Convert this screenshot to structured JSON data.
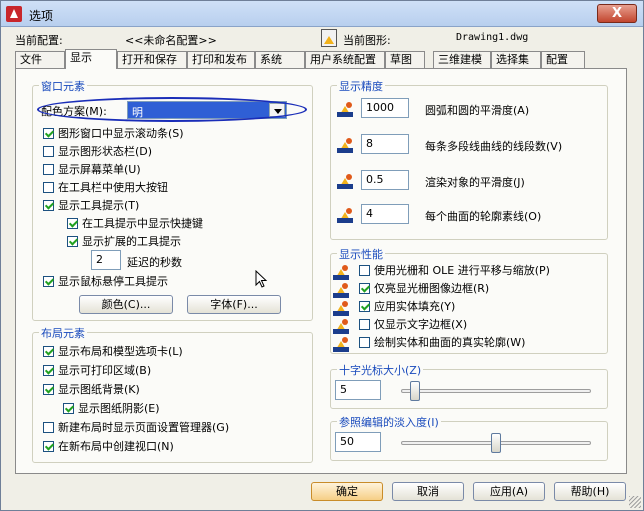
{
  "window": {
    "title": "选项",
    "close_label": "X"
  },
  "profile": {
    "current_profile_label": "当前配置:",
    "current_profile_value": "<<未命名配置>>",
    "current_drawing_label": "当前图形:",
    "current_drawing_value": "Drawing1.dwg"
  },
  "tabs": [
    {
      "label": "文件"
    },
    {
      "label": "显示"
    },
    {
      "label": "打开和保存"
    },
    {
      "label": "打印和发布"
    },
    {
      "label": "系统"
    },
    {
      "label": "用户系统配置"
    },
    {
      "label": "草图"
    },
    {
      "label": "三维建模"
    },
    {
      "label": "选择集"
    },
    {
      "label": "配置"
    }
  ],
  "window_elements": {
    "title": "窗口元素",
    "color_scheme_label": "配色方案(M):",
    "color_scheme_value": "明",
    "checkboxes": [
      {
        "label": "图形窗口中显示滚动条(S)",
        "checked": true
      },
      {
        "label": "显示图形状态栏(D)",
        "checked": false
      },
      {
        "label": "显示屏幕菜单(U)",
        "checked": false
      },
      {
        "label": "在工具栏中使用大按钮",
        "checked": false
      },
      {
        "label": "显示工具提示(T)",
        "checked": true
      },
      {
        "label": "在工具提示中显示快捷键",
        "checked": true
      },
      {
        "label": "显示扩展的工具提示",
        "checked": true
      },
      {
        "label": "显示鼠标悬停工具提示",
        "checked": true
      }
    ],
    "delay_value": "2",
    "delay_label": "延迟的秒数",
    "colors_button": "颜色(C)...",
    "fonts_button": "字体(F)..."
  },
  "layout_elements": {
    "title": "布局元素",
    "checkboxes": [
      {
        "label": "显示布局和模型选项卡(L)",
        "checked": true
      },
      {
        "label": "显示可打印区域(B)",
        "checked": true
      },
      {
        "label": "显示图纸背景(K)",
        "checked": true
      },
      {
        "label": "显示图纸阴影(E)",
        "checked": true
      },
      {
        "label": "新建布局时显示页面设置管理器(G)",
        "checked": false
      },
      {
        "label": "在新布局中创建视口(N)",
        "checked": true
      }
    ]
  },
  "display_resolution": {
    "title": "显示精度",
    "items": [
      {
        "value": "1000",
        "label": "圆弧和圆的平滑度(A)"
      },
      {
        "value": "8",
        "label": "每条多段线曲线的线段数(V)"
      },
      {
        "value": "0.5",
        "label": "渲染对象的平滑度(J)"
      },
      {
        "value": "4",
        "label": "每个曲面的轮廓素线(O)"
      }
    ]
  },
  "display_performance": {
    "title": "显示性能",
    "checkboxes": [
      {
        "label": "使用光栅和 OLE 进行平移与缩放(P)",
        "checked": false
      },
      {
        "label": "仅亮显光栅图像边框(R)",
        "checked": true
      },
      {
        "label": "应用实体填充(Y)",
        "checked": true
      },
      {
        "label": "仅显示文字边框(X)",
        "checked": false
      },
      {
        "label": "绘制实体和曲面的真实轮廓(W)",
        "checked": false
      }
    ]
  },
  "crosshair": {
    "title": "十字光标大小(Z)",
    "value": "5",
    "level_percent": 5
  },
  "xref_fade": {
    "title": "参照编辑的淡入度(I)",
    "value": "50",
    "level_percent": 50
  },
  "buttons": {
    "ok": "确定",
    "cancel": "取消",
    "apply": "应用(A)",
    "help": "帮助(H)"
  }
}
